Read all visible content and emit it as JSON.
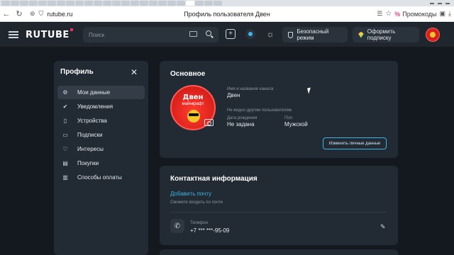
{
  "browser": {
    "url": "rutube.ru",
    "tab_title": "Профиль пользователя Двен",
    "promo_label": "Промокоды"
  },
  "header": {
    "logo": "RUTUBE",
    "search_placeholder": "Поиск",
    "safe_mode_label": "Безопасный режим",
    "subscribe_label": "Оформить подписку"
  },
  "sidebar": {
    "title": "Профиль",
    "items": [
      {
        "label": "Мои данные",
        "icon": "gear-icon",
        "active": true
      },
      {
        "label": "Уведомления",
        "icon": "check-icon"
      },
      {
        "label": "Устройства",
        "icon": "device-icon"
      },
      {
        "label": "Подписки",
        "icon": "subscriptions-icon"
      },
      {
        "label": "Интересы",
        "icon": "heart-icon"
      },
      {
        "label": "Покупки",
        "icon": "card-icon"
      },
      {
        "label": "Способы оплаты",
        "icon": "wallet-icon"
      }
    ]
  },
  "main": {
    "title": "Основное",
    "avatar_name": "Двен",
    "avatar_caption": "майнкрафт",
    "name_label": "Имя и название канала",
    "name_value": "Двен",
    "hidden_note": "Не видно другим пользователям",
    "birth_label": "Дата рождения",
    "birth_value": "Не задана",
    "gender_label": "Пол",
    "gender_value": "Мужской",
    "edit_button": "Изменить личные данные"
  },
  "contact": {
    "title": "Контактная информация",
    "add_email": "Добавить почту",
    "hint": "Сможете входить по почте",
    "phone_label": "Телефон",
    "phone_value": "+7 *** ***-95-09"
  }
}
